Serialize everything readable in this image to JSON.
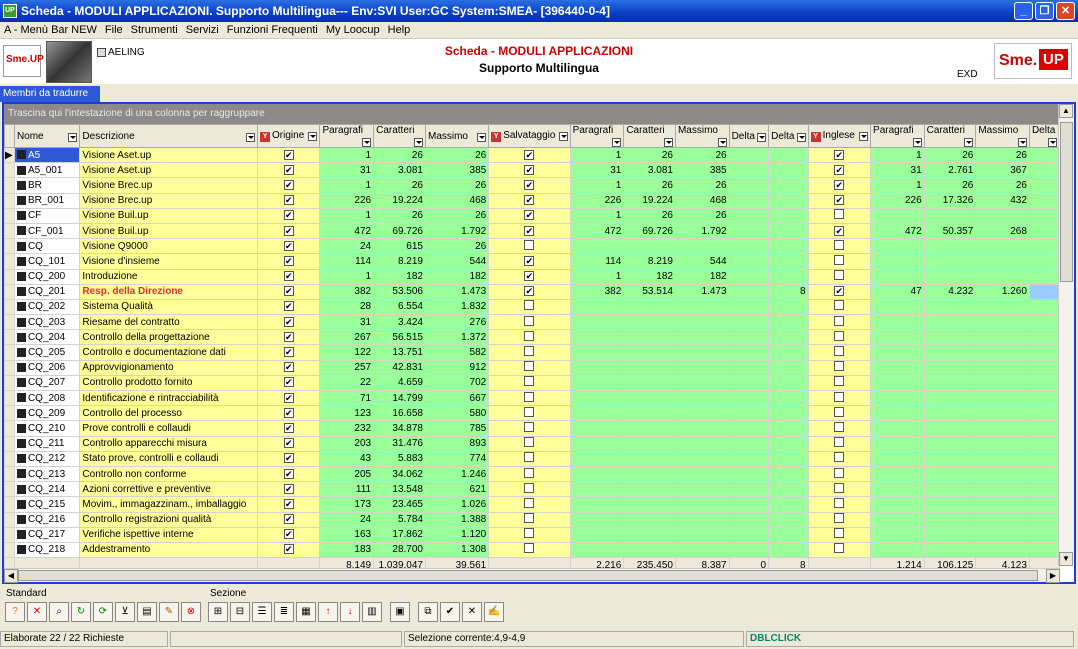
{
  "window": {
    "title": "Scheda - MODULI APPLICAZIONI. Supporto Multilingua--- Env:SVI User:GC System:SMEA- [396440-0-4]",
    "app_icon": "UP"
  },
  "menu": [
    "A - Menù Bar NEW",
    "File",
    "Strumenti",
    "Servizi",
    "Funzioni Frequenti",
    "My Loocup",
    "Help"
  ],
  "header": {
    "logo_left": "Sme.UP",
    "user_label": "AELING",
    "title1": "Scheda - MODULI APPLICAZIONI",
    "title2": "Supporto Multilingua",
    "exd": "EXD",
    "logo_right_sme": "Sme.",
    "logo_right_up": "UP"
  },
  "tab": {
    "label": "Membri da tradurre"
  },
  "grid": {
    "group_hint": "Trascina qui l'intestazione di una colonna per raggruppare",
    "columns": [
      "Nome",
      "Descrizione",
      "Origine",
      "Paragrafi",
      "Caratteri",
      "Massimo",
      "Salvataggio",
      "Paragrafi",
      "Caratteri",
      "Massimo",
      "Delta",
      "Delta",
      "Inglese",
      "Paragrafi",
      "Caratteri",
      "Massimo",
      "Delta"
    ],
    "rows": [
      [
        "A5",
        "Visione Aset.up",
        1,
        "1",
        "26",
        "26",
        1,
        "1",
        "26",
        "26",
        "",
        "",
        1,
        "1",
        "26",
        "26"
      ],
      [
        "A5_001",
        "Visione Aset.up",
        1,
        "31",
        "3.081",
        "385",
        1,
        "31",
        "3.081",
        "385",
        "",
        "",
        1,
        "31",
        "2.761",
        "367"
      ],
      [
        "BR",
        "Visione Brec.up",
        1,
        "1",
        "26",
        "26",
        1,
        "1",
        "26",
        "26",
        "",
        "",
        1,
        "1",
        "26",
        "26"
      ],
      [
        "BR_001",
        "Visione Brec.up",
        1,
        "226",
        "19.224",
        "468",
        1,
        "226",
        "19.224",
        "468",
        "",
        "",
        1,
        "226",
        "17.326",
        "432"
      ],
      [
        "CF",
        "Visione Buil.up",
        1,
        "1",
        "26",
        "26",
        1,
        "1",
        "26",
        "26",
        "",
        "",
        0,
        "",
        "",
        ""
      ],
      [
        "CF_001",
        "Visione Buil.up",
        1,
        "472",
        "69.726",
        "1.792",
        1,
        "472",
        "69.726",
        "1.792",
        "",
        "",
        1,
        "472",
        "50.357",
        "268"
      ],
      [
        "CQ",
        "Visione Q9000",
        1,
        "24",
        "615",
        "26",
        0,
        "",
        "",
        "",
        "",
        "",
        0,
        "",
        "",
        ""
      ],
      [
        "CQ_101",
        "Visione d'insieme",
        1,
        "114",
        "8.219",
        "544",
        1,
        "114",
        "8.219",
        "544",
        "",
        "",
        0,
        "",
        "",
        ""
      ],
      [
        "CQ_200",
        "Introduzione",
        1,
        "1",
        "182",
        "182",
        1,
        "1",
        "182",
        "182",
        "",
        "",
        0,
        "",
        "",
        ""
      ],
      [
        "CQ_201",
        "Resp. della Direzione",
        1,
        "382",
        "53.506",
        "1.473",
        1,
        "382",
        "53.514",
        "1.473",
        "",
        "8",
        1,
        "47",
        "4.232",
        "1.260"
      ],
      [
        "CQ_202",
        "Sistema Qualità",
        1,
        "28",
        "6.554",
        "1.832",
        0,
        "",
        "",
        "",
        "",
        "",
        0,
        "",
        "",
        ""
      ],
      [
        "CQ_203",
        "Riesame del contratto",
        1,
        "31",
        "3.424",
        "276",
        0,
        "",
        "",
        "",
        "",
        "",
        0,
        "",
        "",
        ""
      ],
      [
        "CQ_204",
        "Controllo della progettazione",
        1,
        "267",
        "56.515",
        "1.372",
        0,
        "",
        "",
        "",
        "",
        "",
        0,
        "",
        "",
        ""
      ],
      [
        "CQ_205",
        "Controllo e documentazione dati",
        1,
        "122",
        "13.751",
        "582",
        0,
        "",
        "",
        "",
        "",
        "",
        0,
        "",
        "",
        ""
      ],
      [
        "CQ_206",
        "Approvvigionamento",
        1,
        "257",
        "42.831",
        "912",
        0,
        "",
        "",
        "",
        "",
        "",
        0,
        "",
        "",
        ""
      ],
      [
        "CQ_207",
        "Controllo prodotto fornito",
        1,
        "22",
        "4.659",
        "702",
        0,
        "",
        "",
        "",
        "",
        "",
        0,
        "",
        "",
        ""
      ],
      [
        "CQ_208",
        "Identificazione e rintracciabilità",
        1,
        "71",
        "14.799",
        "667",
        0,
        "",
        "",
        "",
        "",
        "",
        0,
        "",
        "",
        ""
      ],
      [
        "CQ_209",
        "Controllo del processo",
        1,
        "123",
        "16.658",
        "580",
        0,
        "",
        "",
        "",
        "",
        "",
        0,
        "",
        "",
        ""
      ],
      [
        "CQ_210",
        "Prove controlli e collaudi",
        1,
        "232",
        "34.878",
        "785",
        0,
        "",
        "",
        "",
        "",
        "",
        0,
        "",
        "",
        ""
      ],
      [
        "CQ_211",
        "Controllo apparecchi misura",
        1,
        "203",
        "31.476",
        "893",
        0,
        "",
        "",
        "",
        "",
        "",
        0,
        "",
        "",
        ""
      ],
      [
        "CQ_212",
        "Stato prove, controlli e collaudi",
        1,
        "43",
        "5.883",
        "774",
        0,
        "",
        "",
        "",
        "",
        "",
        0,
        "",
        "",
        ""
      ],
      [
        "CQ_213",
        "Controllo non conforme",
        1,
        "205",
        "34.062",
        "1.246",
        0,
        "",
        "",
        "",
        "",
        "",
        0,
        "",
        "",
        ""
      ],
      [
        "CQ_214",
        "Azioni correttive e preventive",
        1,
        "111",
        "13.548",
        "621",
        0,
        "",
        "",
        "",
        "",
        "",
        0,
        "",
        "",
        ""
      ],
      [
        "CQ_215",
        "Movim., immagazzinam., imballaggio",
        1,
        "173",
        "23.465",
        "1.026",
        0,
        "",
        "",
        "",
        "",
        "",
        0,
        "",
        "",
        ""
      ],
      [
        "CQ_216",
        "Controllo registrazioni qualità",
        1,
        "24",
        "5.784",
        "1.388",
        0,
        "",
        "",
        "",
        "",
        "",
        0,
        "",
        "",
        ""
      ],
      [
        "CQ_217",
        "Verifiche ispettive interne",
        1,
        "163",
        "17.862",
        "1.120",
        0,
        "",
        "",
        "",
        "",
        "",
        0,
        "",
        "",
        ""
      ],
      [
        "CQ_218",
        "Addestramento",
        1,
        "183",
        "28.700",
        "1.308",
        0,
        "",
        "",
        "",
        "",
        "",
        0,
        "",
        "",
        ""
      ]
    ],
    "totals": [
      "",
      "",
      "",
      "8.149",
      "1.039.047",
      "39.561",
      "",
      "2.216",
      "235.450",
      "8.387",
      "0",
      "8",
      "",
      "1.214",
      "106.125",
      "4.123",
      ""
    ]
  },
  "toolbar": {
    "standard_label": "Standard",
    "sezione_label": "Sezione"
  },
  "status": {
    "left": "Elaborate 22 / 22 Richieste",
    "selection": "Selezione corrente:4,9-4,9",
    "event": "DBLCLICK"
  }
}
